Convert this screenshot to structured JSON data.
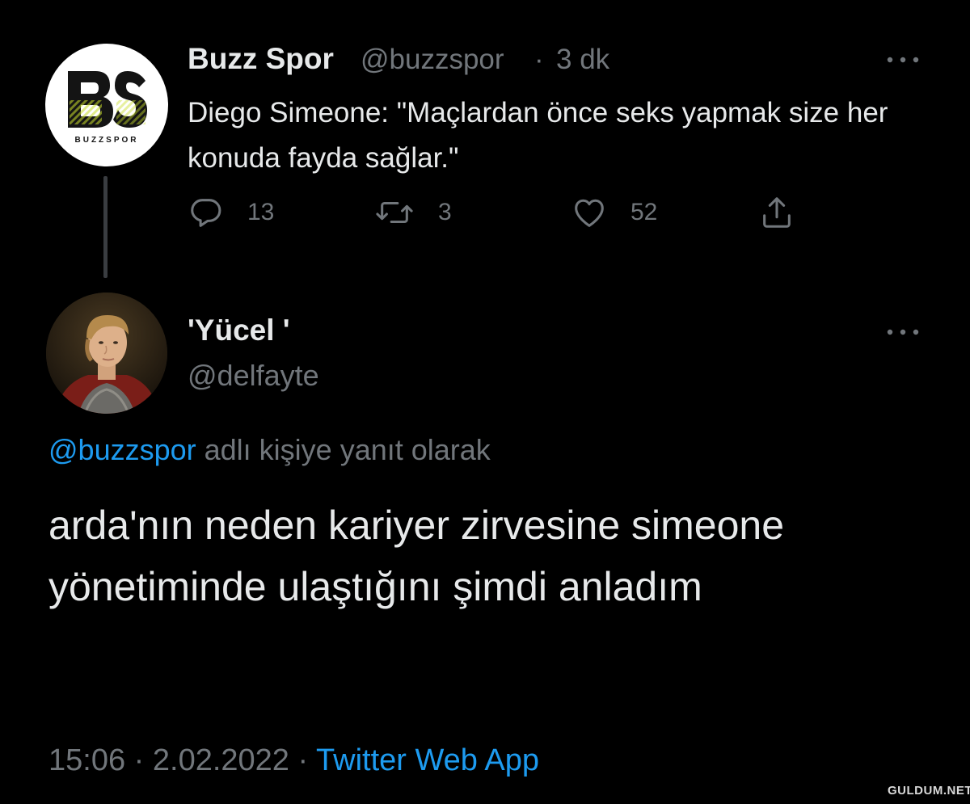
{
  "colors": {
    "background": "#000000",
    "primary_text": "#e7e9ea",
    "secondary_text": "#71767b",
    "link": "#1d9bf0",
    "thread_line": "#3a3d41"
  },
  "parent_tweet": {
    "display_name": "Buzz Spor",
    "handle": "@buzzspor",
    "separator": "·",
    "time_ago": "3 dk",
    "avatar": {
      "logo_text": "BS",
      "caption": "BUZZSPOR",
      "colors": {
        "letters": "#141414",
        "accent": "#c9de2b"
      }
    },
    "text": "Diego Simeone: \"Maçlardan önce seks yapmak size her konuda fayda sağlar.\"",
    "actions": {
      "replies": "13",
      "retweets": "3",
      "likes": "52",
      "icons": [
        "comment-icon",
        "retweet-icon",
        "heart-icon",
        "share-icon"
      ]
    },
    "more_icon": "more-horizontal-icon"
  },
  "reply_tweet": {
    "display_name": "'Yücel '",
    "handle": "@delfayte",
    "more_icon": "more-horizontal-icon",
    "replying_to": {
      "mention": "@buzzspor",
      "suffix": " adlı kişiye yanıt olarak"
    },
    "text": "arda'nın neden kariyer zirvesine simeone yönetiminde ulaştığını şimdi anladım",
    "meta": {
      "time": "15:06",
      "separator1": " · ",
      "date": "2.02.2022",
      "separator2": " · ",
      "source": "Twitter Web App"
    }
  },
  "watermark": "GULDUM.NET"
}
